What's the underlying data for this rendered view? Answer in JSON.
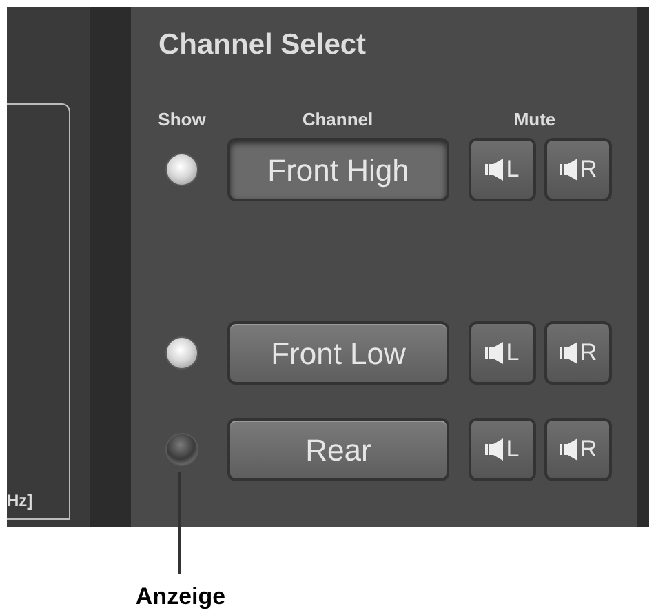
{
  "graph": {
    "axis_label": "Hz]"
  },
  "panel": {
    "title": "Channel Select",
    "headers": [
      "Show",
      "Channel",
      "Mute"
    ]
  },
  "channels": [
    {
      "name": "Front High",
      "show": true,
      "selected": true,
      "mute": [
        "L",
        "R"
      ]
    },
    {
      "name": "Front Low",
      "show": true,
      "selected": false,
      "mute": [
        "L",
        "R"
      ]
    },
    {
      "name": "Rear",
      "show": false,
      "selected": false,
      "mute": [
        "L",
        "R"
      ]
    }
  ],
  "callout": {
    "label": "Anzeige"
  }
}
